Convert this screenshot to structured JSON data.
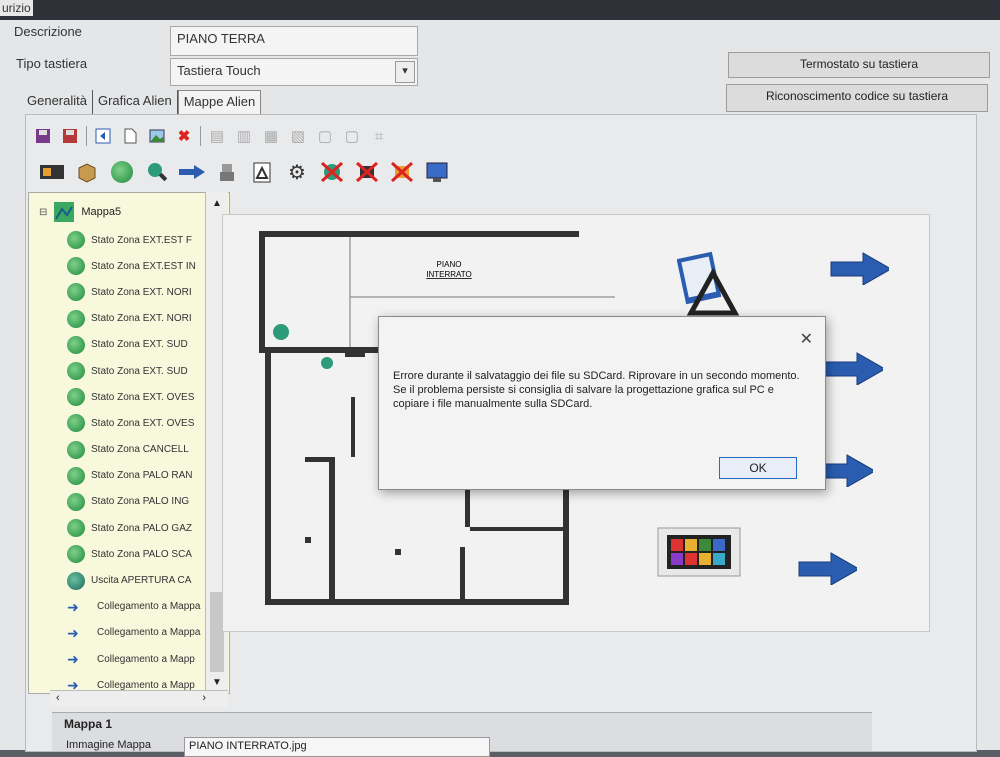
{
  "window": {
    "title_fragment": "urizio"
  },
  "form": {
    "descrizione_label": "Descrizione",
    "descrizione_value": "PIANO TERRA",
    "tipo_label": "Tipo tastiera",
    "tipo_value": "Tastiera Touch"
  },
  "buttons": {
    "termostato": "Termostato su tastiera",
    "riconoscimento": "Riconoscimento codice su tastiera"
  },
  "tabs": [
    {
      "label": "Generalità"
    },
    {
      "label": "Grafica Alien"
    },
    {
      "label": "Mappe Alien"
    }
  ],
  "tree": {
    "root_label": "Mappa5",
    "items": [
      {
        "label": "Stato Zona EXT.EST F",
        "icon": "green-sensor"
      },
      {
        "label": "Stato Zona EXT.EST IN",
        "icon": "green-sensor"
      },
      {
        "label": "Stato Zona EXT. NORI",
        "icon": "green-sensor"
      },
      {
        "label": "Stato Zona EXT. NORI",
        "icon": "green-sensor"
      },
      {
        "label": "Stato Zona EXT. SUD",
        "icon": "green-sensor"
      },
      {
        "label": "Stato Zona EXT. SUD",
        "icon": "green-sensor"
      },
      {
        "label": "Stato Zona EXT. OVES",
        "icon": "green-sensor"
      },
      {
        "label": "Stato Zona EXT. OVES",
        "icon": "green-sensor"
      },
      {
        "label": "Stato Zona CANCELL",
        "icon": "green-sensor"
      },
      {
        "label": "Stato Zona PALO RAN",
        "icon": "green-sensor"
      },
      {
        "label": "Stato Zona PALO ING",
        "icon": "green-sensor"
      },
      {
        "label": "Stato Zona PALO GAZ",
        "icon": "green-sensor"
      },
      {
        "label": "Stato Zona PALO SCA",
        "icon": "green-sensor"
      },
      {
        "label": "Uscita APERTURA CA",
        "icon": "magnifier"
      },
      {
        "label": "Collegamento a Mappa",
        "icon": "blue-arrow"
      },
      {
        "label": "Collegamento a Mappa",
        "icon": "blue-arrow"
      },
      {
        "label": "Collegamento a Mapp",
        "icon": "blue-arrow"
      },
      {
        "label": "Collegamento a Mapp",
        "icon": "blue-arrow"
      }
    ]
  },
  "plan": {
    "label_1": "PIANO",
    "label_2": "INTERRATO"
  },
  "dialog": {
    "message": "Errore durante il salvataggio dei file su SDCard. Riprovare in un secondo momento. Se il problema persiste si consiglia di salvare la progettazione grafica sul PC e copiare i file manualmente sulla SDCard.",
    "ok_label": "OK"
  },
  "bottom": {
    "title": "Mappa 1",
    "image_label": "Immagine Mappa",
    "image_value": "PIANO INTERRATO.jpg"
  },
  "colors": {
    "accent": "#2a68c8",
    "tree_bg": "#f8f8dd",
    "arrow": "#2a5db0"
  }
}
